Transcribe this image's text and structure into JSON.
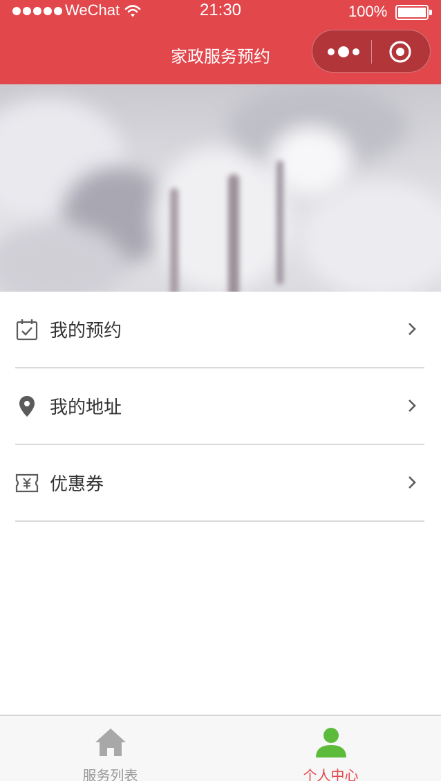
{
  "status_bar": {
    "carrier": "WeChat",
    "time": "21:30",
    "battery": "100%",
    "signal_bars": 5,
    "battery_level": 1.0
  },
  "nav": {
    "title": "家政服务预约",
    "capsule_icons": [
      "more-dots-icon",
      "close-target-icon"
    ]
  },
  "menu": {
    "items": [
      {
        "label": "我的预约",
        "icon": "calendar-check-icon"
      },
      {
        "label": "我的地址",
        "icon": "location-pin-icon"
      },
      {
        "label": "优惠券",
        "icon": "coupon-yen-icon"
      }
    ]
  },
  "tabbar": {
    "tabs": [
      {
        "label": "服务列表",
        "icon": "home-icon",
        "active": false
      },
      {
        "label": "个人中心",
        "icon": "person-icon",
        "active": true
      }
    ]
  },
  "colors": {
    "brand": "#e2474c",
    "active_tab_icon": "#5dbb3c",
    "inactive": "#9a9a9a"
  }
}
